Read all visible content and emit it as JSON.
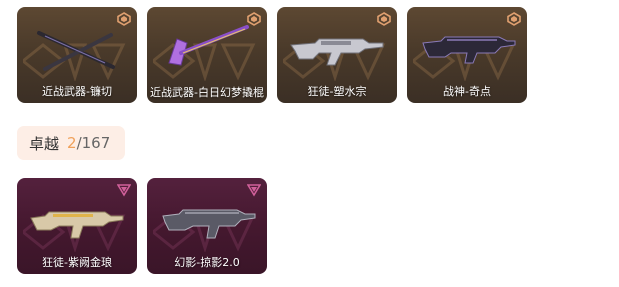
{
  "top_row": [
    {
      "name": "近战武器-镰切",
      "tier_color": "#e0a070"
    },
    {
      "name": "近战武器-白日幻梦撬棍",
      "tier_color": "#e0a070"
    },
    {
      "name": "狂徒-塑水宗",
      "tier_color": "#e0a070"
    },
    {
      "name": "战神-奇点",
      "tier_color": "#e0a070"
    }
  ],
  "tier_chip": {
    "name": "卓越",
    "owned": "2",
    "separator": "/",
    "total": "167",
    "accent": "#f0a15a"
  },
  "bottom_row": [
    {
      "name": "狂徒-紫阙金琅",
      "tier_color": "#d0609a"
    },
    {
      "name": "幻影-掠影2.0",
      "tier_color": "#d0609a"
    }
  ]
}
